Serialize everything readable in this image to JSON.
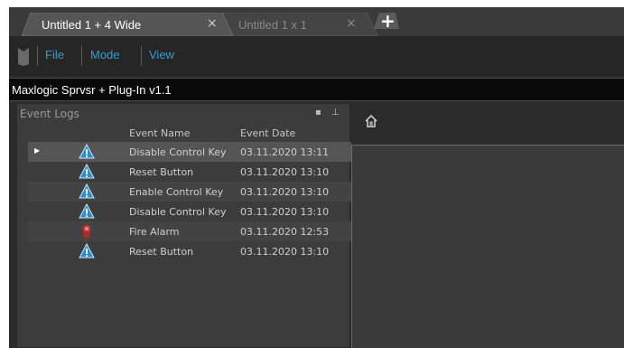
{
  "tabs": [
    {
      "label": "Untitled 1 + 4 Wide",
      "close": "×",
      "active": true
    },
    {
      "label": "Untitled 1 x 1",
      "close": "×",
      "active": false
    }
  ],
  "add_tab": {
    "glyph": "+"
  },
  "menu": {
    "logo_icon": "app-logo-icon",
    "items": [
      {
        "label": "File"
      },
      {
        "label": "Mode"
      },
      {
        "label": "View"
      }
    ]
  },
  "title_bar": {
    "text": "Maxlogic Sprvsr + Plug-In v1.1"
  },
  "event_logs": {
    "title": "Event Logs",
    "pin_glyph": "▪",
    "dock_glyph": "⊥",
    "columns": [
      "Event Name",
      "Event Date"
    ],
    "rows": [
      {
        "icon": "warning-icon",
        "name": "Disable Control Key",
        "date": "03.11.2020 13:11",
        "selected": true
      },
      {
        "icon": "warning-icon",
        "name": "Reset Button",
        "date": "03.11.2020 13:10",
        "selected": false
      },
      {
        "icon": "warning-icon",
        "name": "Enable Control Key",
        "date": "03.11.2020 13:10",
        "selected": false
      },
      {
        "icon": "warning-icon",
        "name": "Disable Control Key",
        "date": "03.11.2020 13:10",
        "selected": false
      },
      {
        "icon": "fire-alarm-icon",
        "name": "Fire Alarm",
        "date": "03.11.2020 12:53",
        "selected": false
      },
      {
        "icon": "warning-icon",
        "name": "Reset Button",
        "date": "03.11.2020 13:10",
        "selected": false
      }
    ]
  },
  "right_pane": {
    "home_icon": "home-icon"
  },
  "colors": {
    "accent": "#2d9fd6",
    "warning": "#2a8fd0",
    "alarm": "#d23a3a",
    "panel_bg": "#3c3c3c"
  }
}
